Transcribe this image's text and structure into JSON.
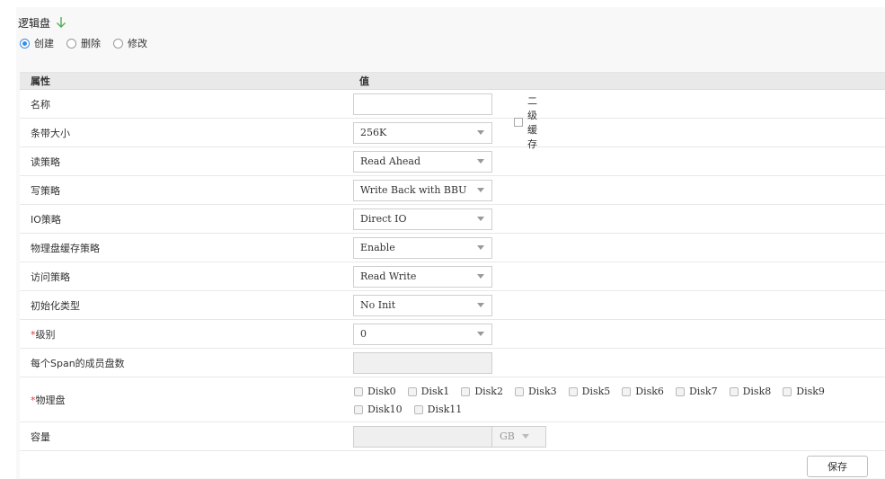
{
  "title": "逻辑盘",
  "modes": [
    {
      "label": "创建",
      "checked": true
    },
    {
      "label": "删除",
      "checked": false
    },
    {
      "label": "修改",
      "checked": false
    }
  ],
  "table": {
    "header": {
      "attr": "属性",
      "value": "值"
    },
    "rows": {
      "name": {
        "label": "名称",
        "value": "",
        "l2cache_label": "二级缓存"
      },
      "stripe": {
        "label": "条带大小",
        "value": "256K"
      },
      "read": {
        "label": "读策略",
        "value": "Read Ahead"
      },
      "write": {
        "label": "写策略",
        "value": "Write Back with BBU"
      },
      "io": {
        "label": "IO策略",
        "value": "Direct IO"
      },
      "pdcache": {
        "label": "物理盘缓存策略",
        "value": "Enable"
      },
      "access": {
        "label": "访问策略",
        "value": "Read Write"
      },
      "init": {
        "label": "初始化类型",
        "value": "No Init"
      },
      "level": {
        "label": "级别",
        "required_mark": "*",
        "value": "0"
      },
      "span": {
        "label": "每个Span的成员盘数",
        "value": ""
      },
      "disks": {
        "label": "物理盘",
        "required_mark": "*",
        "line1": [
          "Disk0",
          "Disk1",
          "Disk2",
          "Disk3",
          "Disk5",
          "Disk6",
          "Disk7",
          "Disk8",
          "Disk9"
        ],
        "line2": [
          "Disk10",
          "Disk11"
        ]
      },
      "capacity": {
        "label": "容量",
        "value": "",
        "unit": "GB"
      }
    }
  },
  "save_label": "保存",
  "colors": {
    "accent": "#3a8ee6",
    "required": "#e4393c",
    "arrow": "#4caf50"
  }
}
